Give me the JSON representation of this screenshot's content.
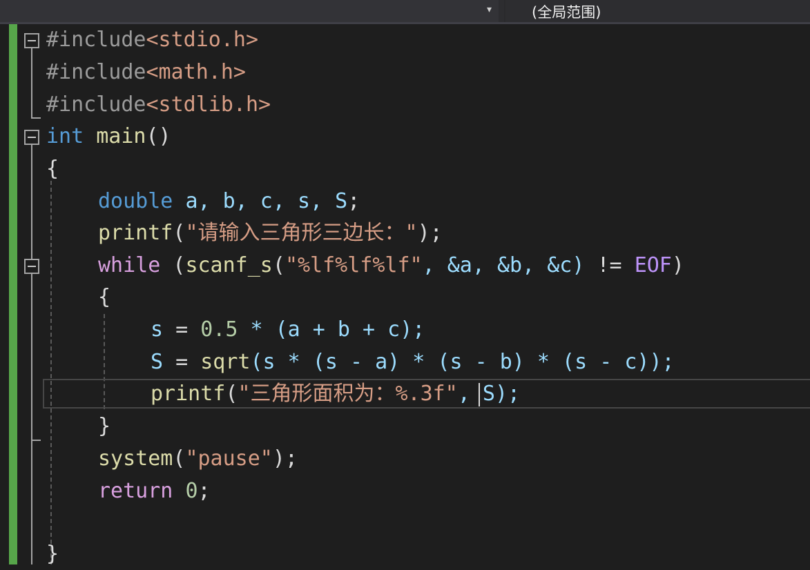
{
  "toolbar": {
    "scope_label": "(全局范围)",
    "dropdown_glyph": "▾"
  },
  "code": {
    "line1": {
      "directive": "#include",
      "header": "<stdio.h>"
    },
    "line2": {
      "directive": "#include",
      "header": "<math.h>"
    },
    "line3": {
      "directive": "#include",
      "header": "<stdlib.h>"
    },
    "line4": {
      "type": "int",
      "name": "main",
      "args": "()"
    },
    "line5": {
      "brace": "{"
    },
    "line6": {
      "type": "double",
      "vars": "a, b, c, s, S",
      "end": ";"
    },
    "line7": {
      "fn": "printf",
      "open": "(",
      "str": "\"请输入三角形三边长：\"",
      "close": ");"
    },
    "line8": {
      "kw": "while",
      "open": " (",
      "fn": "scanf_s",
      "p1": "(",
      "str": "\"%lf%lf%lf\"",
      "args_text": ", &a, &b, &c)",
      "op": " != ",
      "macro": "EOF",
      "close": ")"
    },
    "line9": {
      "brace": "{"
    },
    "line10": {
      "var1": "s",
      "op1": " = ",
      "num": "0.5",
      "rest": " * (a + b + c);"
    },
    "line11": {
      "var1": "S",
      "op1": " = ",
      "fn": "sqrt",
      "rest": "(s * (s - a) * (s - b) * (s - c));"
    },
    "line12": {
      "fn": "printf",
      "open": "(",
      "str": "\"三角形面积为：%.3f\"",
      "rest": ", S);"
    },
    "line13": {
      "brace": "}"
    },
    "line14": {
      "fn": "system",
      "open": "(",
      "str": "\"pause\"",
      "close": ");"
    },
    "line15": {
      "kw": "return",
      "num": "0",
      "end": ";"
    },
    "line17": {
      "brace": "}"
    }
  },
  "colors": {
    "background": "#1e1e1e",
    "keyword": "#569cd6",
    "control": "#d8a0df",
    "string": "#d69d85",
    "function": "#dcdcaa",
    "variable": "#9cdcfe",
    "number": "#b5cea8",
    "changebar": "#57a64a"
  }
}
